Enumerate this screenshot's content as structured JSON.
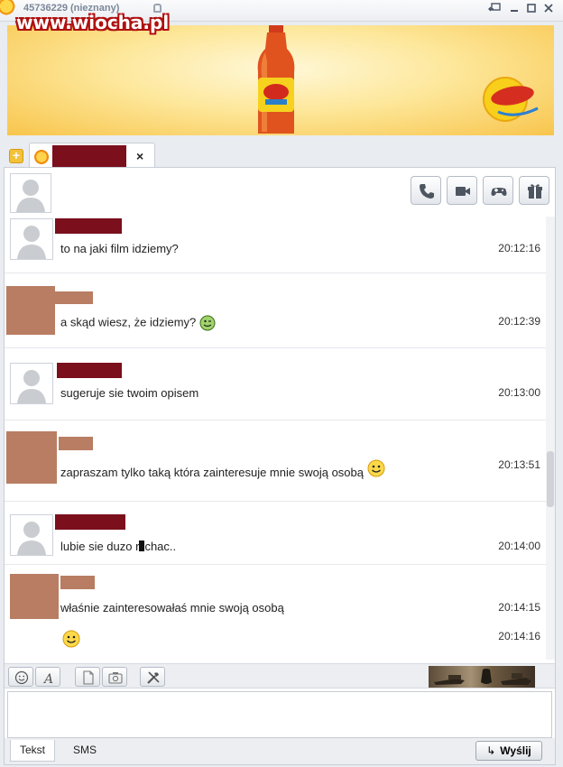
{
  "watermark": "www.wiocha.pl",
  "title_bar": {
    "contact_number": "45736229 (nieznany)"
  },
  "header": {
    "buttons": [
      "phone-icon",
      "video-camera-icon",
      "gamepad-icon",
      "gift-icon"
    ]
  },
  "tab": {
    "close_label": "×"
  },
  "messages": [
    {
      "sender": "contact",
      "text": "to na jaki film idziemy?",
      "time": "20:12:16"
    },
    {
      "sender": "me",
      "text": "a skąd wiesz, że idziemy?",
      "time": "20:12:39",
      "emoticon": "wink-smiley"
    },
    {
      "sender": "contact",
      "text": "sugeruje sie twoim opisem",
      "time": "20:13:00"
    },
    {
      "sender": "me",
      "text": "zapraszam tylko taką która zainteresuje mnie swoją osobą",
      "time": "20:13:51",
      "emoticon": "smiley"
    },
    {
      "sender": "contact",
      "text_start": "lubie sie duzo r",
      "text_end": "chac..",
      "time": "20:14:00"
    },
    {
      "sender": "me",
      "text": "właśnie zainteresowałaś mnie swoją osobą",
      "time": "20:14:15",
      "time2": "20:14:16",
      "emoticon": "smiley"
    }
  ],
  "composer": {
    "tools": [
      "emoticon-icon",
      "font-icon",
      "file-icon",
      "photo-icon",
      "tools-icon"
    ],
    "input_value": "",
    "tabs": {
      "text": "Tekst",
      "sms": "SMS"
    },
    "send_label": "Wyślij"
  },
  "colors": {
    "redacted_name": "#7b0f1c",
    "redacted_avatar": "#b87d62",
    "banner_yellow": "#fde79a"
  }
}
